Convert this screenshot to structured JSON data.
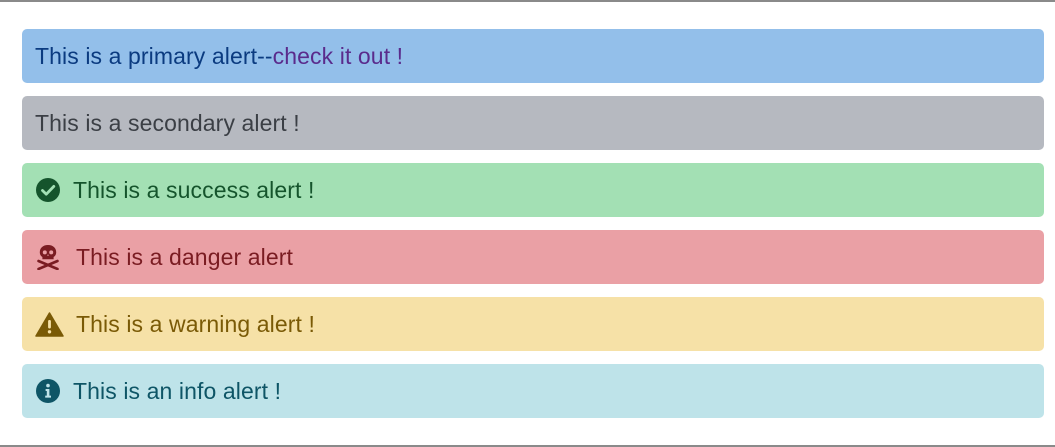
{
  "alerts": {
    "primary": {
      "text": "This is a primary alert--",
      "link": " check it out !",
      "color": "#93bfea"
    },
    "secondary": {
      "text": "This is a secondary alert !",
      "color": "#b6b9c0"
    },
    "success": {
      "icon": "check-circle-icon",
      "text": "This is a success alert !",
      "color": "#a3e0b4"
    },
    "danger": {
      "icon": "skull-crossbones-icon",
      "text": "This is a danger alert",
      "color": "#eaa0a5"
    },
    "warning": {
      "icon": "warning-triangle-icon",
      "text": "This is a warning alert !",
      "color": "#f6e1a7"
    },
    "info": {
      "icon": "info-circle-icon",
      "text": "This is an info alert !",
      "color": "#bee3e9"
    }
  }
}
